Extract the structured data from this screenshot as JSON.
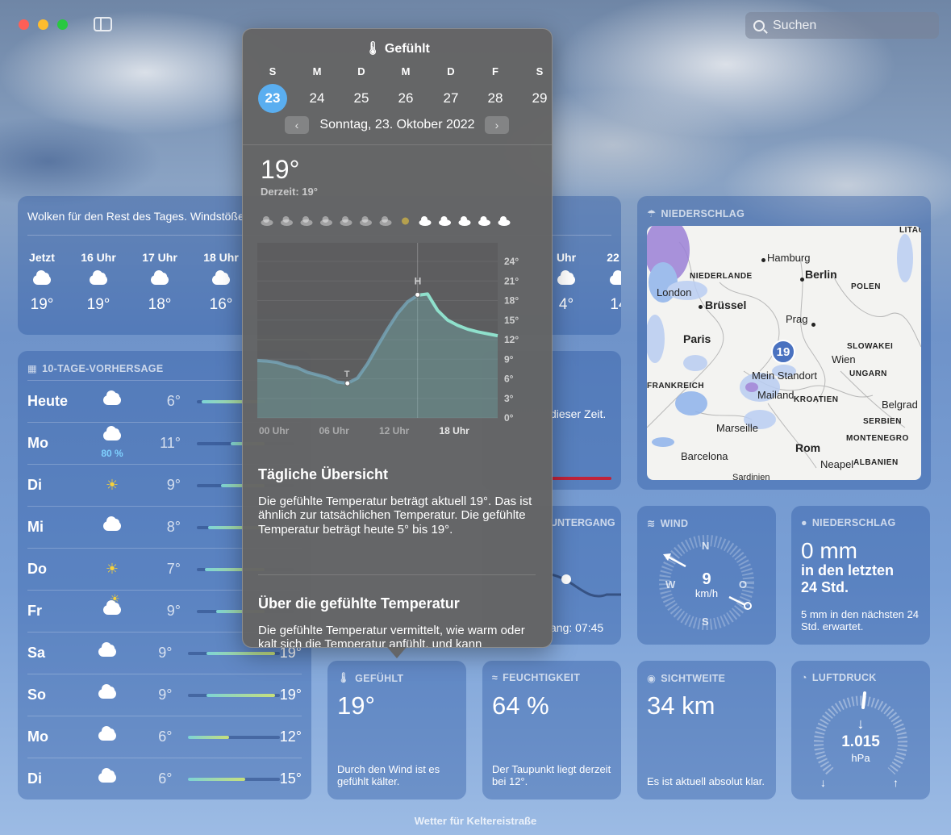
{
  "search": {
    "placeholder": "Suchen"
  },
  "hourly": {
    "summary": "Wolken für den Rest des Tages. Windstöße",
    "hours": [
      {
        "time": "Jetzt",
        "temp": "19°",
        "icon": "cloud-icon"
      },
      {
        "time": "16 Uhr",
        "temp": "19°",
        "icon": "cloud-icon"
      },
      {
        "time": "17 Uhr",
        "temp": "18°",
        "icon": "cloud-icon"
      },
      {
        "time": "18 Uhr",
        "temp": "16°",
        "icon": "cloud-icon"
      }
    ],
    "right_hours": [
      {
        "time": "Uhr",
        "temp": "4°"
      },
      {
        "time": "22 U",
        "temp": "14"
      }
    ]
  },
  "tenday": {
    "title": "10-TAGE-VORHERSAGE",
    "days": [
      {
        "day": "Heute",
        "icon": "cloud-icon",
        "lo": "6°",
        "hi": "",
        "pct": "",
        "bar_start": 0.05,
        "bar_end": 0.7
      },
      {
        "day": "Mo",
        "icon": "rain-cloud-icon",
        "lo": "11°",
        "hi": "",
        "pct": "80 %",
        "bar_start": 0.35,
        "bar_end": 0.7
      },
      {
        "day": "Di",
        "icon": "sun-icon",
        "lo": "9°",
        "hi": "",
        "pct": "",
        "bar_start": 0.25,
        "bar_end": 0.7
      },
      {
        "day": "Mi",
        "icon": "cloud-icon",
        "lo": "8°",
        "hi": "",
        "pct": "",
        "bar_start": 0.12,
        "bar_end": 0.7
      },
      {
        "day": "Do",
        "icon": "sun-icon",
        "lo": "7°",
        "hi": "",
        "pct": "",
        "bar_start": 0.08,
        "bar_end": 0.7
      },
      {
        "day": "Fr",
        "icon": "sun-cloud-icon",
        "lo": "9°",
        "hi": "",
        "pct": "",
        "bar_start": 0.2,
        "bar_end": 0.7
      },
      {
        "day": "Sa",
        "icon": "cloud-icon",
        "lo": "9°",
        "hi": "19°",
        "pct": "",
        "bar_start": 0.2,
        "bar_end": 0.95
      },
      {
        "day": "So",
        "icon": "cloud-icon",
        "lo": "9°",
        "hi": "19°",
        "pct": "",
        "bar_start": 0.2,
        "bar_end": 0.95
      },
      {
        "day": "Mo",
        "icon": "cloud-icon",
        "lo": "6°",
        "hi": "12°",
        "pct": "",
        "bar_start": 0.0,
        "bar_end": 0.45
      },
      {
        "day": "Di",
        "icon": "cloud-icon",
        "lo": "6°",
        "hi": "15°",
        "pct": "",
        "bar_start": 0.0,
        "bar_end": 0.62
      }
    ]
  },
  "map": {
    "title": "NIEDERSCHLAG",
    "pin_value": "19",
    "labels": {
      "hamburg": "Hamburg",
      "berlin": "Berlin",
      "niederlande": "NIEDERLANDE",
      "polen": "POLEN",
      "london": "London",
      "bruessel": "Brüssel",
      "prag": "Prag",
      "paris": "Paris",
      "slowakei": "SLOWAKEI",
      "wien": "Wien",
      "standort": "Mein Standort",
      "ungarn": "UNGARN",
      "frankreich": "FRANKREICH",
      "mailand": "Mailand",
      "kroatien": "KROATIEN",
      "belgrad": "Belgrad",
      "serbien": "SERBIEN",
      "marseille": "Marseille",
      "montenegro": "MONTENEGRO",
      "rom": "Rom",
      "barcelona": "Barcelona",
      "neapel": "Neapel",
      "albanien": "ALBANIEN",
      "sardinien": "Sardinien",
      "litauen": "LITAU"
    }
  },
  "partial": {
    "zeit": "dieser Zeit.",
    "sunset_head": "UNTERGANG",
    "sunset_text": "ang: 07:45"
  },
  "wind": {
    "title": "WIND",
    "speed": "9",
    "unit": "km/h",
    "n": "N",
    "s": "S",
    "w": "W",
    "o": "O"
  },
  "precip": {
    "title": "NIEDERSCHLAG",
    "amount": "0 mm",
    "sub": "in den letzten 24 Std.",
    "desc": "5 mm in den nächsten 24 Std. erwartet."
  },
  "feels": {
    "title": "GEFÜHLT",
    "value": "19°",
    "desc": "Durch den Wind ist es gefühlt kälter."
  },
  "humidity": {
    "title": "FEUCHTIGKEIT",
    "value": "64 %",
    "desc": "Der Taupunkt liegt derzeit bei 12°."
  },
  "visibility": {
    "title": "SICHTWEITE",
    "value": "34 km",
    "desc": "Es ist aktuell absolut klar."
  },
  "pressure": {
    "title": "LUFTDRUCK",
    "value": "1.015",
    "unit": "hPa",
    "low": "↓",
    "high": "↑"
  },
  "popover": {
    "title": "Gefühlt",
    "weekdays": [
      "S",
      "M",
      "D",
      "M",
      "D",
      "F",
      "S"
    ],
    "dates": [
      "23",
      "24",
      "25",
      "26",
      "27",
      "28",
      "29"
    ],
    "selected_index": 0,
    "date_label": "Sonntag, 23. Oktober 2022",
    "current": "19°",
    "current_sub": "Derzeit: 19°",
    "section1_title": "Tägliche Übersicht",
    "section1_text": "Die gefühlte Temperatur beträgt aktuell 19°. Das ist ähnlich zur tatsächlichen Temperatur. Die gefühlte Temperatur beträgt heute 5° bis 19°.",
    "section2_title": "Über die gefühlte Temperatur",
    "section2_text": "Die gefühlte Temperatur vermittelt, wie warm oder kalt sich die Temperatur anfühlt, und kann"
  },
  "chart_data": {
    "type": "area",
    "x_ticks": [
      "00 Uhr",
      "06 Uhr",
      "12 Uhr",
      "18 Uhr"
    ],
    "y_ticks": [
      "0°",
      "3°",
      "6°",
      "9°",
      "12°",
      "15°",
      "18°",
      "21°",
      "24°"
    ],
    "ylim": [
      0,
      24
    ],
    "low_label": "T",
    "high_label": "H",
    "series": [
      {
        "x": [
          0,
          1,
          2,
          3,
          4,
          5,
          6,
          7,
          8,
          9,
          10,
          11,
          12,
          13,
          14,
          15,
          16,
          17,
          18,
          19,
          20,
          21,
          22,
          23,
          24
        ],
        "values": [
          8.8,
          8.7,
          8.5,
          8.0,
          7.7,
          7.0,
          6.6,
          6.2,
          5.5,
          5.3,
          6.1,
          8.3,
          11.0,
          13.6,
          16.0,
          17.8,
          18.8,
          19.0,
          16.5,
          15.0,
          14.2,
          13.6,
          13.2,
          12.9,
          12.6
        ]
      }
    ],
    "icons": [
      "cloud",
      "sun-cloud",
      "sun-cloud",
      "sun-cloud",
      "cloud",
      "cloud",
      "cloud",
      "sun",
      "cloud",
      "cloud",
      "cloud",
      "cloud",
      "cloud"
    ]
  },
  "footer": "Wetter für Keltereistraße"
}
